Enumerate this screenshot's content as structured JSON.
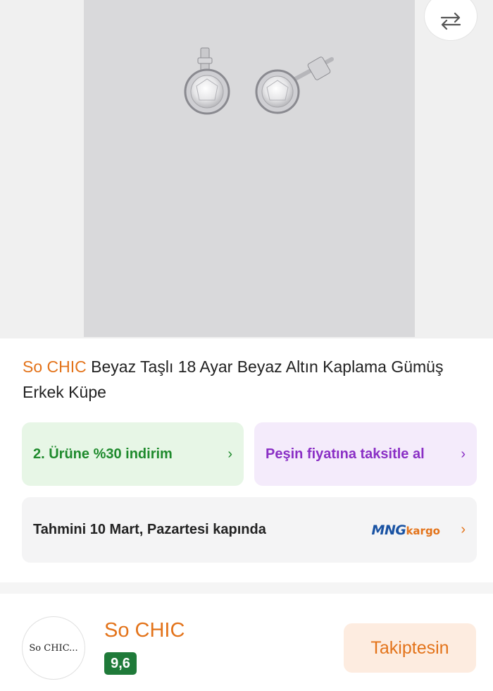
{
  "product": {
    "brand": "So CHIC",
    "title": "Beyaz Taşlı 18 Ayar Beyaz Altın Kaplama Gümüş Erkek Küpe",
    "image_icon": "earrings-photo",
    "compare_icon": "swap-arrows-icon"
  },
  "promos": [
    {
      "label": "2. Ürüne %30 indirim",
      "color": "#1e8a2c",
      "background": "#e7f6e6"
    },
    {
      "label": "Peşin fiyatına taksitle al",
      "color": "#8a2fc5",
      "background": "#f4ebfb"
    }
  ],
  "delivery": {
    "text": "Tahmini 10 Mart, Pazartesi kapında",
    "carrier_logo_main": "MNG",
    "carrier_logo_sub": "kargo"
  },
  "seller": {
    "avatar_text": "So CHIC...",
    "name": "So CHIC",
    "rating": "9,6",
    "follow_label": "Takiptesin"
  },
  "chevron": "›",
  "colors": {
    "accent": "#e3731a",
    "rating_badge": "#1f7a39"
  }
}
